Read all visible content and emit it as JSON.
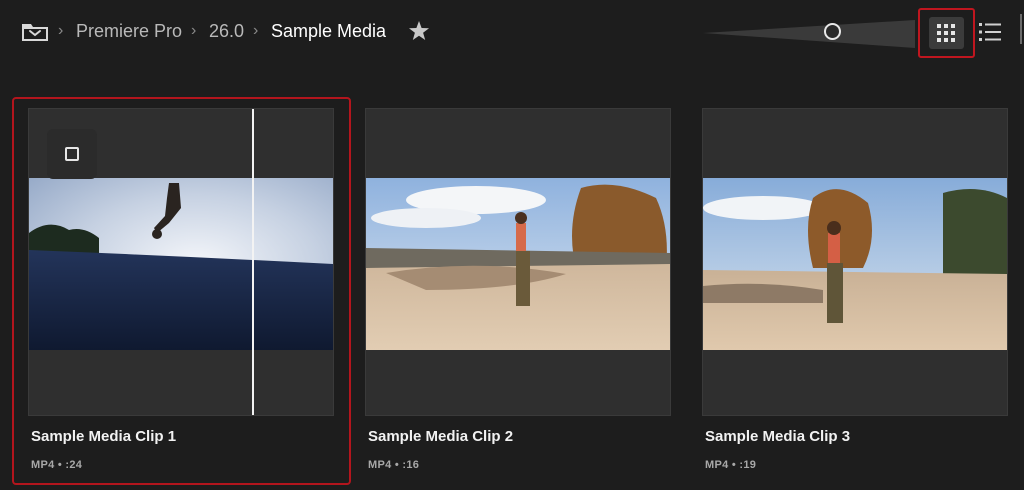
{
  "header": {
    "breadcrumbs": [
      {
        "label": "Premiere Pro"
      },
      {
        "label": "26.0"
      },
      {
        "label": "Sample Media"
      }
    ],
    "separator": "›",
    "icons": {
      "folder": "folder-icon",
      "star": "star-icon",
      "grid": "grid-view-icon",
      "list": "list-view-icon"
    }
  },
  "zoom_slider": {
    "level": 0.61
  },
  "clips": [
    {
      "title": "Sample Media Clip 1",
      "meta": "MP4 • :24",
      "selected": true
    },
    {
      "title": "Sample Media Clip 2",
      "meta": "MP4 • :16",
      "selected": false
    },
    {
      "title": "Sample Media Clip 3",
      "meta": "MP4 • :19",
      "selected": false
    }
  ],
  "colors": {
    "background": "#1d1d1d",
    "selection": "#b3151d",
    "card": "#2f2f2f"
  }
}
